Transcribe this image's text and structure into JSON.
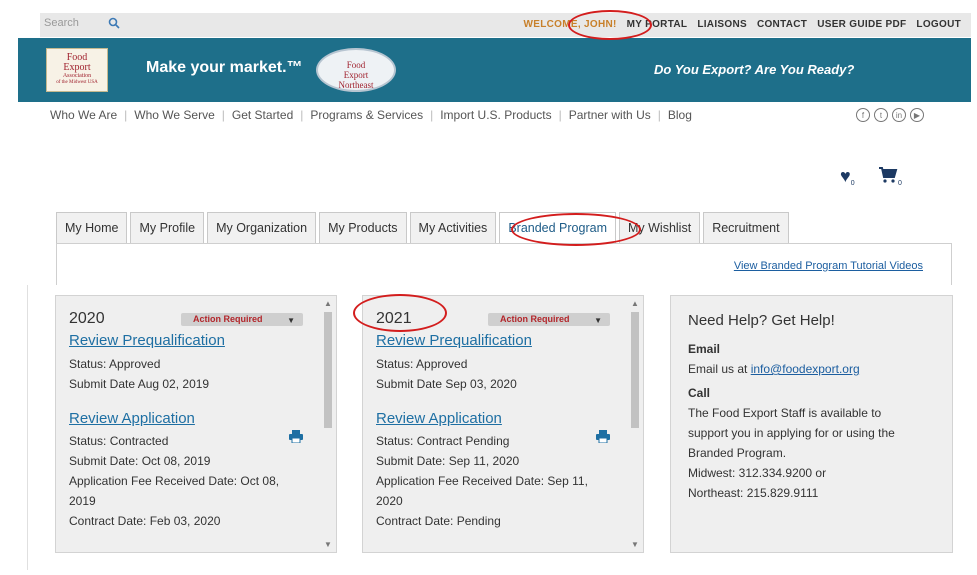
{
  "topbar": {
    "search_placeholder": "Search",
    "welcome": "WELCOME, JOHN!",
    "nav": [
      "MY PORTAL",
      "LIAISONS",
      "CONTACT",
      "USER GUIDE PDF",
      "LOGOUT"
    ]
  },
  "banner": {
    "logo_text": [
      "Food",
      "Export",
      "Association",
      "of the Midwest USA"
    ],
    "tagline": "Make your market.™",
    "badge_text": [
      "Food",
      "Export",
      "Northeast"
    ],
    "export_question": "Do You Export? Are You Ready?"
  },
  "mainnav": [
    "Who We Are",
    "Who We Serve",
    "Get Started",
    "Programs & Services",
    "Import U.S. Products",
    "Partner with Us",
    "Blog"
  ],
  "counts": {
    "wishlist": "0",
    "cart": "0"
  },
  "tabs": [
    "My Home",
    "My Profile",
    "My Organization",
    "My Products",
    "My Activities",
    "Branded Program",
    "My Wishlist",
    "Recruitment"
  ],
  "tutorial_link": "View Branded Program Tutorial Videos",
  "cards": [
    {
      "year": "2020",
      "action": "Action Required",
      "prequal_link": "Review Prequalification",
      "prequal_status": "Status: Approved",
      "prequal_date": "Submit Date Aug 02, 2019",
      "app_link": "Review Application",
      "app_status": "Status: Contracted",
      "app_submit": "Submit Date: Oct 08, 2019",
      "fee_line1": "Application Fee Received Date: Oct 08,",
      "fee_line2": "2019",
      "contract": "Contract Date: Feb 03, 2020"
    },
    {
      "year": "2021",
      "action": "Action Required",
      "prequal_link": "Review Prequalification",
      "prequal_status": "Status: Approved",
      "prequal_date": "Submit Date Sep 03, 2020",
      "app_link": "Review Application",
      "app_status": "Status: Contract Pending",
      "app_submit": "Submit Date: Sep 11, 2020",
      "fee_line1": "Application Fee Received Date: Sep 11,",
      "fee_line2": "2020",
      "contract": "Contract Date: Pending"
    }
  ],
  "help": {
    "title": "Need Help? Get Help!",
    "email_label": "Email",
    "email_prefix": "Email us at ",
    "email": "info@foodexport.org",
    "call_label": "Call",
    "call_lines": [
      "The Food Export Staff is available to",
      "support you in applying for or using the",
      "Branded Program.",
      "Midwest: 312.334.9200 or",
      "Northeast: 215.829.9111"
    ]
  }
}
